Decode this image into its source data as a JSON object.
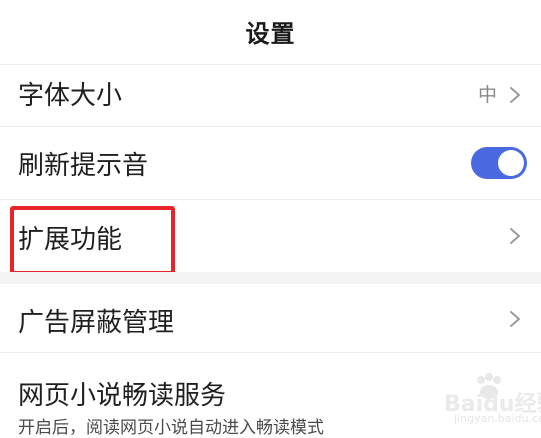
{
  "header": {
    "title": "设置"
  },
  "settings": {
    "font_size": {
      "label": "字体大小",
      "value": "中"
    },
    "refresh_sound": {
      "label": "刷新提示音",
      "enabled": true
    },
    "extensions": {
      "label": "扩展功能"
    },
    "ad_block": {
      "label": "广告屏蔽管理"
    },
    "reading_mode": {
      "label": "网页小说畅读服务",
      "description": "开启后，阅读网页小说自动进入畅读模式"
    }
  },
  "colors": {
    "toggle_on": "#4a69e0",
    "highlight": "#e8242a"
  },
  "icons": {
    "chevron": "chevron-right-icon"
  },
  "watermark": {
    "brand": "Baidu经验",
    "url": "jingyan.baidu.com"
  }
}
